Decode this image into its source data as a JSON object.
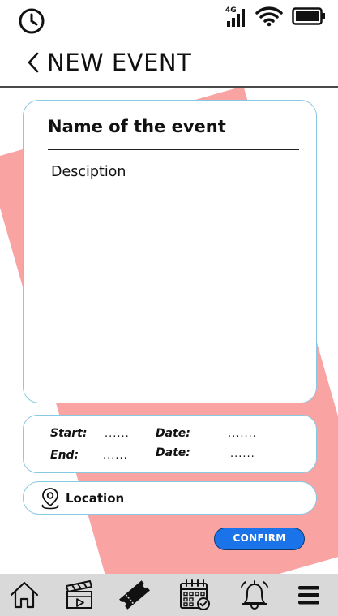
{
  "header": {
    "title": "NEW EVENT"
  },
  "event": {
    "name": "Name of the event",
    "description": "Desciption"
  },
  "time": {
    "start_label": "Start:",
    "start_value": "......",
    "end_label": "End:",
    "end_value": "......",
    "start_date_label": "Date:",
    "start_date_value": ".......",
    "end_date_label": "Date:",
    "end_date_value": "......"
  },
  "location": {
    "label": "Location"
  },
  "actions": {
    "confirm_label": "CONFIRM"
  },
  "status_bar": {
    "network": "4G"
  },
  "icons": [
    "clock-icon",
    "signal-icon",
    "wifi-icon",
    "battery-icon",
    "back-chevron-icon",
    "map-pin-icon",
    "home-icon",
    "clapperboard-icon",
    "ticket-icon",
    "calendar-check-icon",
    "bell-icon",
    "menu-icon"
  ],
  "colors": {
    "accent": "#1a73e8",
    "card_border": "#87c9e3",
    "background_shape": "#f9a3a3",
    "nav_background": "#d9d9d9"
  }
}
